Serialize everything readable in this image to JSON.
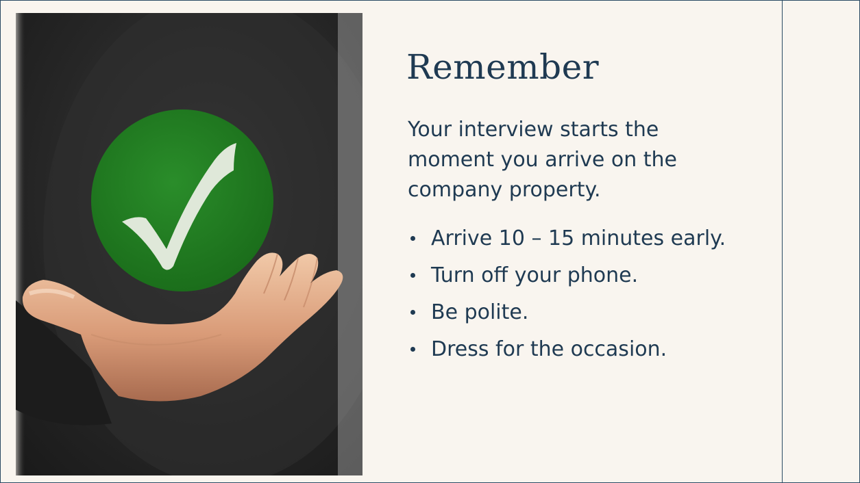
{
  "slide": {
    "title": "Remember",
    "intro": "Your interview starts the moment you arrive on the company property.",
    "bullets": [
      "Arrive 10 – 15 minutes early.",
      "Turn off your phone.",
      "Be polite.",
      "Dress for the occasion."
    ]
  },
  "image": {
    "description_icon": "checkmark-icon",
    "check_color": "#1e7d1e",
    "check_mark_color": "#dfe8d9"
  },
  "colors": {
    "background": "#f9f5ef",
    "text": "#1f3a52",
    "border": "#2a4a63"
  }
}
